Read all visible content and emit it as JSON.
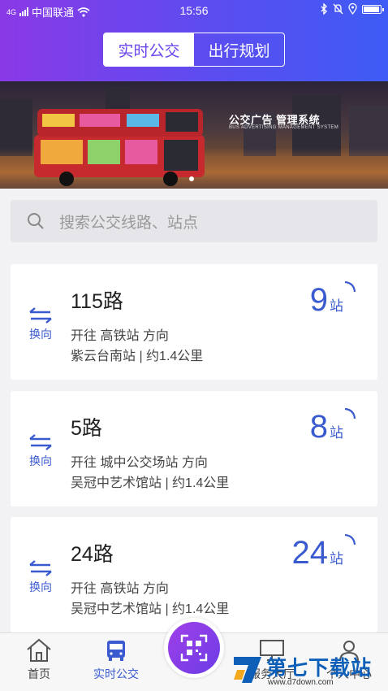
{
  "status_bar": {
    "signal_label": "4G",
    "carrier": "中国联通",
    "time": "15:56"
  },
  "header": {
    "tabs": [
      {
        "label": "实时公交",
        "active": true
      },
      {
        "label": "出行规划",
        "active": false
      }
    ],
    "gradient_start": "#8a39e6",
    "gradient_end": "#3e5bf5"
  },
  "banner": {
    "title": "公交广告 管理系统",
    "subtitle": "BUS ADVERTISING MANAGEMENT SYSTEM",
    "page_count": 1,
    "active_page": 1
  },
  "search": {
    "placeholder": "搜索公交线路、站点",
    "icon": "search-icon"
  },
  "routes": [
    {
      "name": "115路",
      "direction": "开往 高铁站 方向",
      "nearest": "紫云台南站 | 约1.4公里",
      "eta": "9",
      "eta_unit": "站",
      "swap_label": "换向"
    },
    {
      "name": "5路",
      "direction": "开往 城中公交场站 方向",
      "nearest": "吴冠中艺术馆站 | 约1.4公里",
      "eta": "8",
      "eta_unit": "站",
      "swap_label": "换向"
    },
    {
      "name": "24路",
      "direction": "开往 高铁站 方向",
      "nearest": "吴冠中艺术馆站 | 约1.4公里",
      "eta": "24",
      "eta_unit": "站",
      "swap_label": "换向"
    }
  ],
  "tabbar": {
    "items": [
      {
        "label": "首页",
        "icon": "home-icon",
        "active": false
      },
      {
        "label": "实时公交",
        "icon": "bus-icon",
        "active": true
      },
      {
        "label": "服务大厅",
        "icon": "monitor-icon",
        "active": false
      },
      {
        "label": "个人中心",
        "icon": "user-icon",
        "active": false
      }
    ],
    "center_icon": "qr-scan-icon"
  },
  "watermark": {
    "text": "第七下载站",
    "url": "www.d7down.com"
  },
  "accent_color": "#3a5bd0"
}
